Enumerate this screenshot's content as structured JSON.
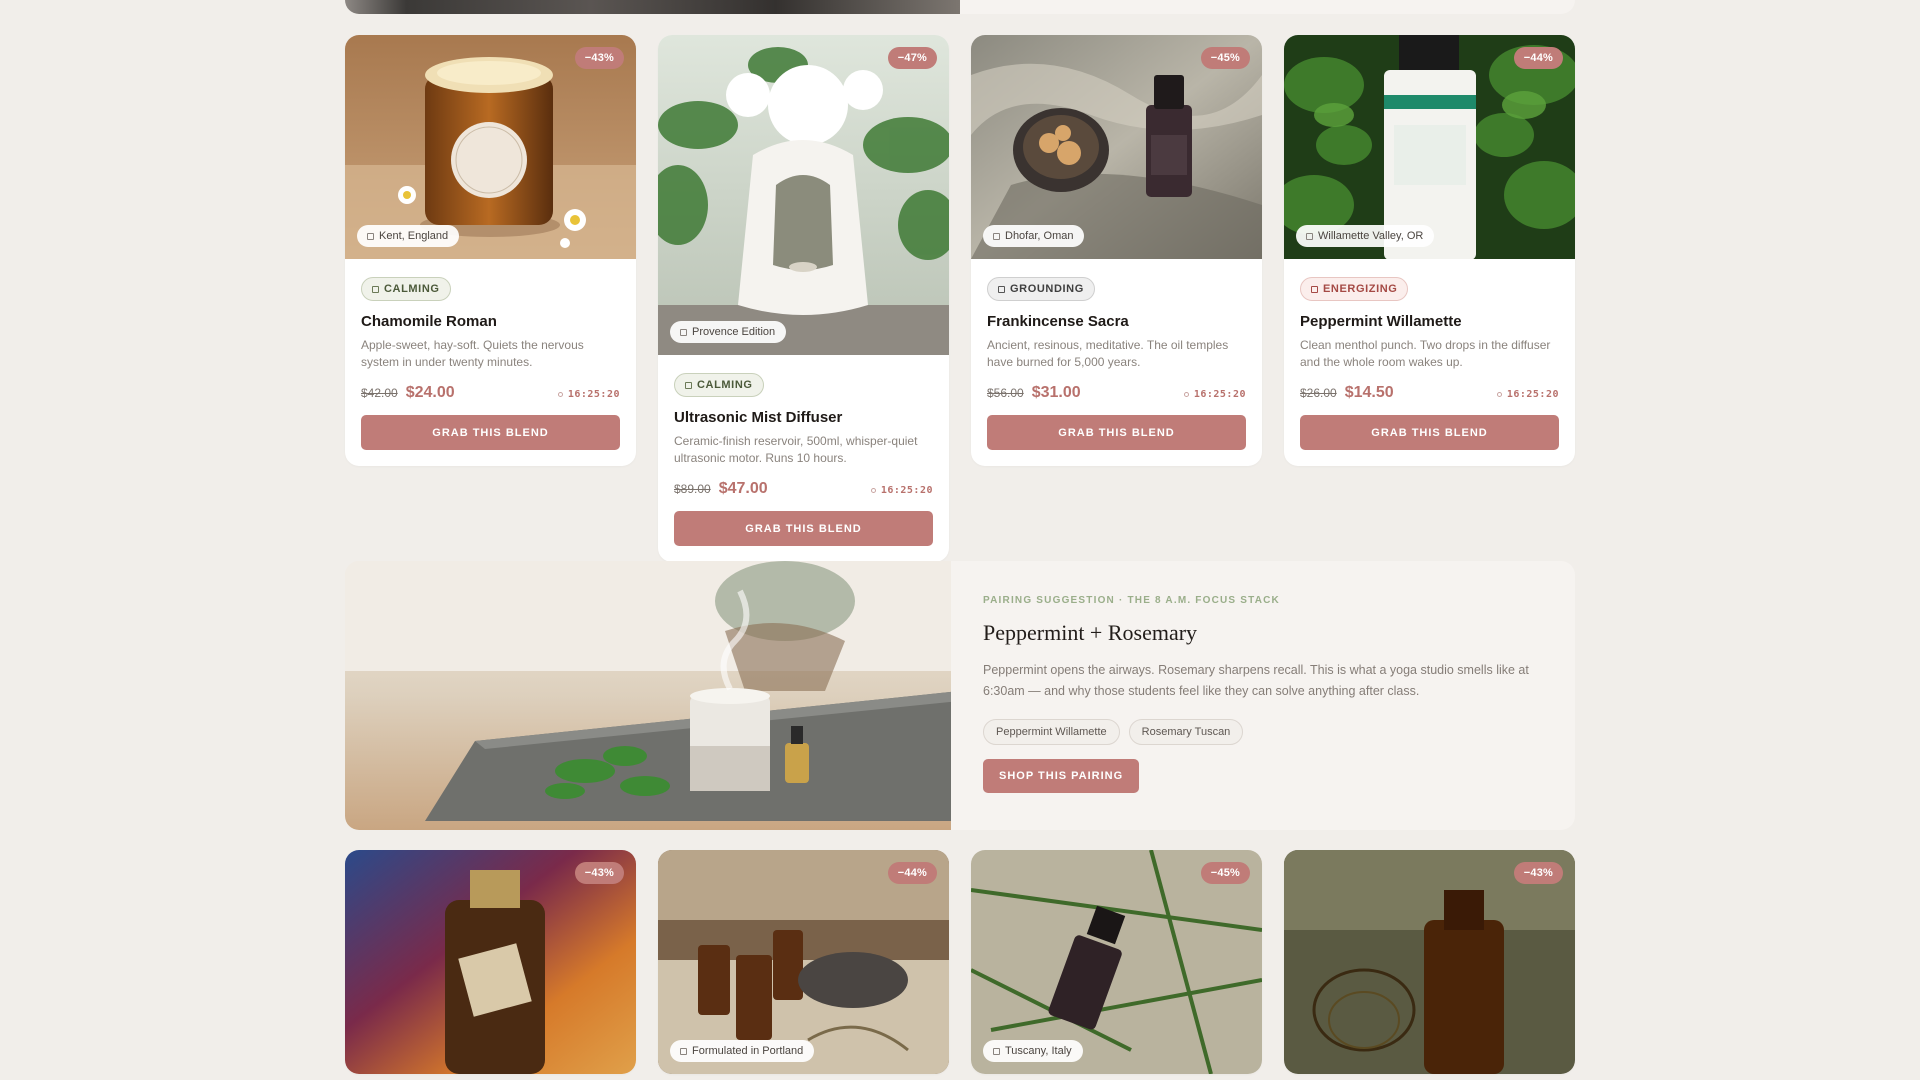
{
  "products_row1": [
    {
      "discount": "−43%",
      "origin": "Kent, England",
      "tag": "CALMING",
      "title": "Chamomile Roman",
      "desc": "Apple-sweet, hay-soft. Quiets the nervous system in under twenty minutes.",
      "old_price": "$42.00",
      "price": "$24.00",
      "timer": "16:25:20",
      "cta": "GRAB THIS BLEND"
    },
    {
      "discount": "−47%",
      "origin": "Provence Edition",
      "tag": "CALMING",
      "title": "Ultrasonic Mist Diffuser",
      "desc": "Ceramic-finish reservoir, 500ml, whisper-quiet ultrasonic motor. Runs 10 hours.",
      "old_price": "$89.00",
      "price": "$47.00",
      "timer": "16:25:20",
      "cta": "GRAB THIS BLEND"
    },
    {
      "discount": "−45%",
      "origin": "Dhofar, Oman",
      "tag": "GROUNDING",
      "title": "Frankincense Sacra",
      "desc": "Ancient, resinous, meditative. The oil temples have burned for 5,000 years.",
      "old_price": "$56.00",
      "price": "$31.00",
      "timer": "16:25:20",
      "cta": "GRAB THIS BLEND"
    },
    {
      "discount": "−44%",
      "origin": "Willamette Valley, OR",
      "tag": "ENERGIZING",
      "title": "Peppermint Willamette",
      "desc": "Clean menthol punch. Two drops in the diffuser and the whole room wakes up.",
      "old_price": "$26.00",
      "price": "$14.50",
      "timer": "16:25:20",
      "cta": "GRAB THIS BLEND"
    }
  ],
  "pairing": {
    "eyebrow": "PAIRING SUGGESTION · THE 8 A.M. FOCUS STACK",
    "title": "Peppermint + Rosemary",
    "desc": "Peppermint opens the airways. Rosemary sharpens recall. This is what a yoga studio smells like at 6:30am — and why those students feel like they can solve anything after class.",
    "chips": [
      "Peppermint Willamette",
      "Rosemary Tuscan"
    ],
    "cta": "SHOP THIS PAIRING"
  },
  "products_row2": [
    {
      "discount": "−43%",
      "origin": ""
    },
    {
      "discount": "−44%",
      "origin": "Formulated in Portland"
    },
    {
      "discount": "−45%",
      "origin": "Tuscany, Italy"
    },
    {
      "discount": "−43%",
      "origin": ""
    }
  ],
  "colors": {
    "accent": "#c07c78",
    "background": "#f1eeea",
    "calming": "#4c5a3a",
    "energizing": "#a54a45"
  }
}
